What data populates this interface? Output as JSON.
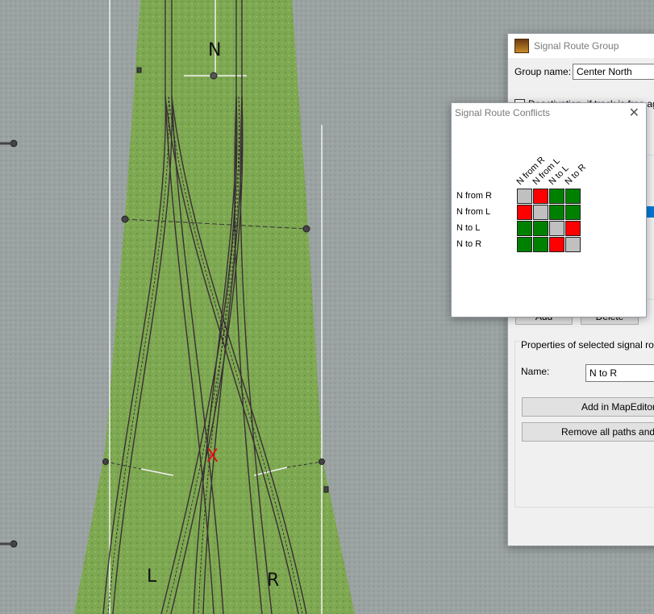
{
  "map": {
    "labels": {
      "north": "N",
      "left": "L",
      "right": "R",
      "cross": "X"
    }
  },
  "group_window": {
    "title": "Signal Route Group",
    "group_name_label": "Group name:",
    "group_name_value": "Center North",
    "deactivation_text": "Deactivation, if track is free again",
    "properties_label": "Properties of selected signal route",
    "name_label": "Name:",
    "name_value": "N to R",
    "add_label": "Add",
    "delete_label": "Delete",
    "add_mapeditor_label": "Add in MapEditor selection",
    "remove_all_label": "Remove all paths and switches"
  },
  "conflicts_window": {
    "title": "Signal Route Conflicts",
    "routes": [
      "N from R",
      "N from L",
      "N to L",
      "N to R"
    ],
    "matrix": [
      [
        "self",
        "conflict",
        "ok",
        "ok"
      ],
      [
        "conflict",
        "self",
        "ok",
        "ok"
      ],
      [
        "ok",
        "ok",
        "self",
        "conflict"
      ],
      [
        "ok",
        "ok",
        "conflict",
        "self"
      ]
    ],
    "colors": {
      "self": "#c0c0c0",
      "conflict": "#ff0000",
      "ok": "#008000"
    }
  }
}
